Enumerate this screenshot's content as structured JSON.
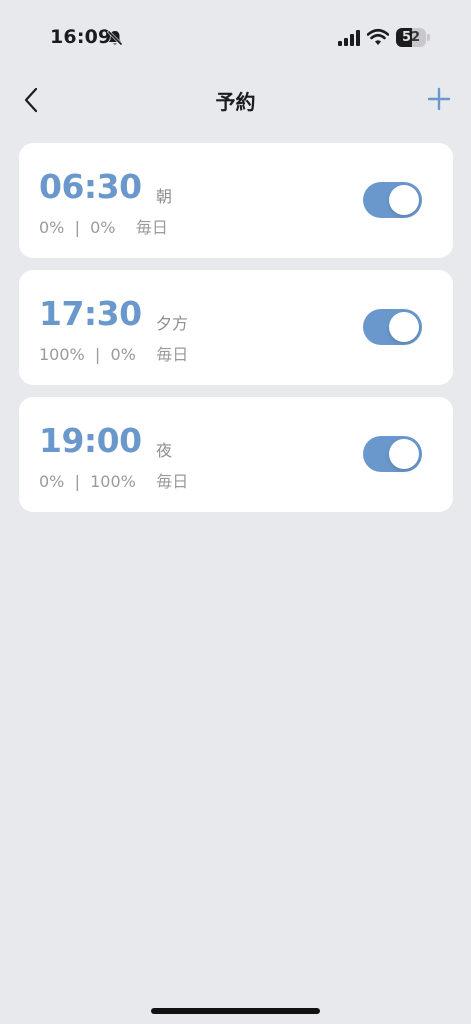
{
  "status_bar": {
    "time": "16:09",
    "battery": "52",
    "battery_fraction": 0.52,
    "icons": [
      "bell-slash-icon",
      "cellular-signal-icon",
      "wifi-icon",
      "battery-icon"
    ]
  },
  "nav": {
    "title": "予約",
    "back_icon": "chevron-left-icon",
    "add_icon": "plus-icon"
  },
  "colors": {
    "accent": "#6a98cc",
    "background": "#e8e9ed",
    "card": "#ffffff",
    "secondary_text": "#9a9aa0"
  },
  "schedules": [
    {
      "time": "06:30",
      "label": "朝",
      "level_a": "0%",
      "level_b": "0%",
      "repeat": "毎日",
      "enabled": true
    },
    {
      "time": "17:30",
      "label": "夕方",
      "level_a": "100%",
      "level_b": "0%",
      "repeat": "毎日",
      "enabled": true
    },
    {
      "time": "19:00",
      "label": "夜",
      "level_a": "0%",
      "level_b": "100%",
      "repeat": "毎日",
      "enabled": true
    }
  ]
}
